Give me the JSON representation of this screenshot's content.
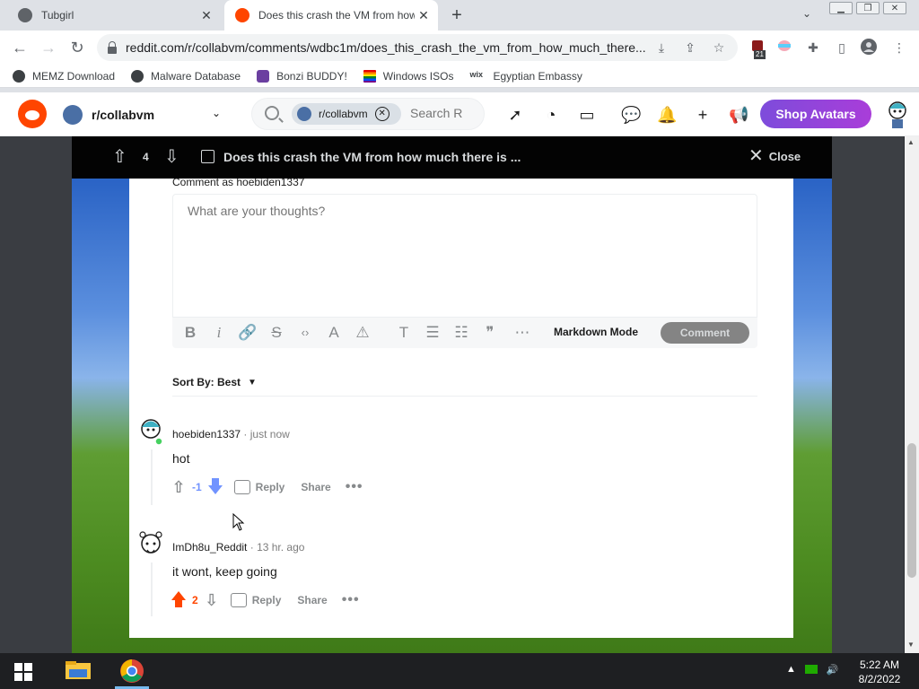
{
  "browser": {
    "tabs": [
      {
        "title": "Tubgirl",
        "active": false
      },
      {
        "title": "Does this crash the VM from how",
        "active": true
      }
    ],
    "url": "reddit.com/r/collabvm/comments/wdbc1m/does_this_crash_the_vm_from_how_much_there...",
    "extension_badge": "21",
    "bookmarks": [
      "MEMZ Download",
      "Malware Database",
      "Bonzi BUDDY!",
      "Windows ISOs",
      "Egyptian Embassy"
    ]
  },
  "reddit_header": {
    "community": "r/collabvm",
    "search_chip": "r/collabvm",
    "search_placeholder": "Search R",
    "shop_button": "Shop Avatars"
  },
  "post_bar": {
    "score": "4",
    "title": "Does this crash the VM from how much there is ...",
    "close_label": "Close"
  },
  "comment_box": {
    "comment_as": "Comment as hoebiden1337",
    "placeholder": "What are your thoughts?",
    "markdown_mode": "Markdown Mode",
    "comment_button": "Comment"
  },
  "sort": {
    "label": "Sort By: Best"
  },
  "comments": [
    {
      "author": "hoebiden1337",
      "time": "just now",
      "body": "hot",
      "score": "-1",
      "vote": "down",
      "reply_label": "Reply",
      "share_label": "Share"
    },
    {
      "author": "ImDh8u_Reddit",
      "time": "13 hr. ago",
      "body": "it wont, keep going",
      "score": "2",
      "vote": "up",
      "reply_label": "Reply",
      "share_label": "Share"
    }
  ],
  "taskbar": {
    "time": "5:22 AM",
    "date": "8/2/2022"
  },
  "colors": {
    "reddit_orange": "#ff4500",
    "downvote_blue": "#7193ff",
    "upvote_orange": "#ff4500",
    "shop_purple": "#8b45dc"
  }
}
